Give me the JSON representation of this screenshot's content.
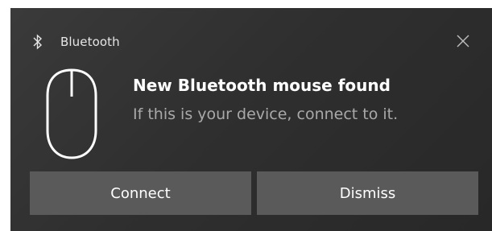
{
  "toast": {
    "app_name": "Bluetooth",
    "app_icon": "bluetooth-icon",
    "close_icon": "close-icon",
    "device_icon": "mouse-icon",
    "title": "New Bluetooth mouse found",
    "message": "If this is your device, connect to it.",
    "buttons": {
      "connect_label": "Connect",
      "dismiss_label": "Dismiss"
    }
  },
  "colors": {
    "background": "#2f2f2f",
    "button": "#5a5a5a",
    "title_text": "#ffffff",
    "message_text": "#a9a9a9"
  }
}
